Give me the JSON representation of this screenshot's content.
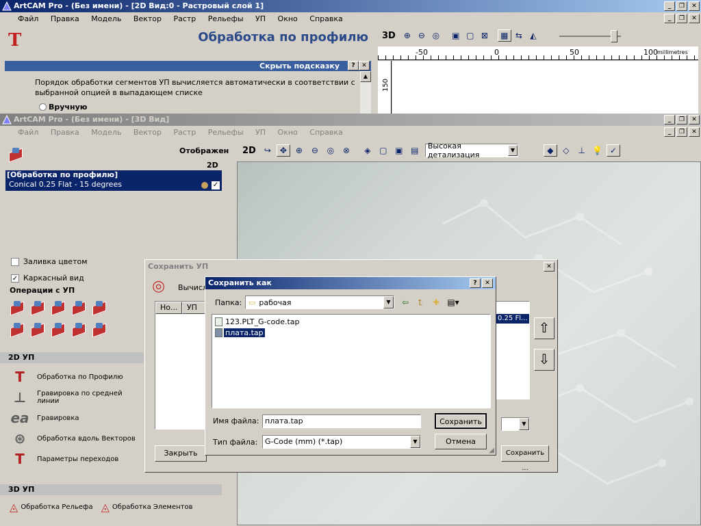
{
  "top_window": {
    "title": "ArtCAM Pro - (Без имени) - [2D Вид:0 - Растровый слой 1]",
    "menu": [
      "Файл",
      "Правка",
      "Модель",
      "Вектор",
      "Растр",
      "Рельефы",
      "УП",
      "Окно",
      "Справка"
    ],
    "panel_title": "Обработка по профилю",
    "hint_bar": "Скрыть подсказку",
    "hint_text": "Порядок обработки сегментов УП вычисляется автоматически в соответствии с выбранной опцией в выпадающем списке",
    "radio_manual": "Вручную",
    "view_label": "3D",
    "ruler": {
      "labels": [
        "-50",
        "0",
        "50",
        "100"
      ],
      "unit": "millimetres",
      "vlabel": "150"
    }
  },
  "second_window": {
    "title": "ArtCAM Pro - (Без имени) - [3D Вид]",
    "menu": [
      "Файл",
      "Правка",
      "Модель",
      "Вектор",
      "Растр",
      "Рельефы",
      "УП",
      "Окно",
      "Справка"
    ],
    "display_label": "Отображен",
    "view_2d": "2D",
    "toolpath_title": "[Обработка по профилю]",
    "toolpath_tool": "Conical 0.25 Flat - 15 degrees",
    "fill_color": "Заливка цветом",
    "wireframe": "Каркасный вид",
    "ops_header": "Операции с УП",
    "hdr_2d": "2D УП",
    "items_2d": [
      "Обработка по Профилю",
      "Гравировка по средней линии",
      "Гравировка",
      "Обработка вдоль Векторов",
      "Параметры переходов"
    ],
    "hdr_3d": "3D УП",
    "items_3d": [
      "Обработка Рельефа",
      "Обработка Элементов"
    ],
    "toolbar_2d": "2D",
    "detail_select": "Высокая детализация"
  },
  "save_up_dialog": {
    "title": "Сохранить УП",
    "calc_label": "Вычисл",
    "col1": "Но...",
    "col2": "УП",
    "right_item": "0.25 Fl...",
    "close_btn": "Закрыть",
    "save_btn": "Сохранить ..."
  },
  "save_as_dialog": {
    "title": "Сохранить как",
    "folder_label": "Папка:",
    "folder_value": "рабочая",
    "files": [
      "123.PLT_G-code.tap",
      "плата.tap"
    ],
    "filename_label": "Имя файла:",
    "filename_value": "плата.tap",
    "filetype_label": "Тип файла:",
    "filetype_value": "G-Code (mm) (*.tap)",
    "save_btn": "Сохранить",
    "cancel_btn": "Отмена"
  }
}
